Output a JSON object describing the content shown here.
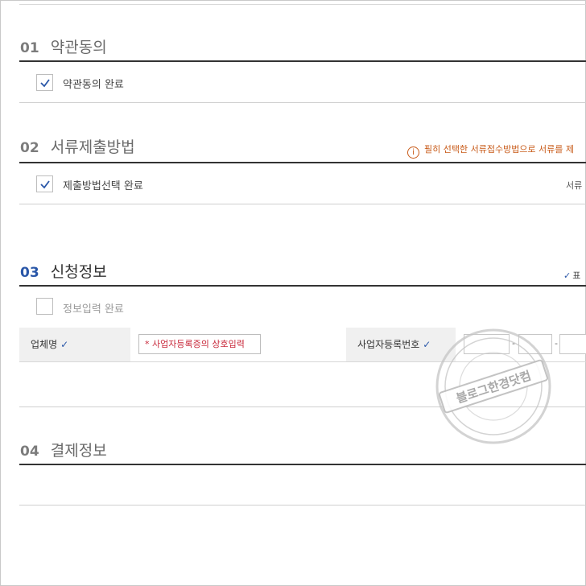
{
  "sections": [
    {
      "num": "01",
      "label": "약관동의",
      "check_label": "약관동의 완료",
      "checked": true
    },
    {
      "num": "02",
      "label": "서류제출방법",
      "check_label": "제출방법선택 완료",
      "checked": true
    },
    {
      "num": "03",
      "label": "신청정보",
      "check_label": "정보입력 완료",
      "checked": false
    },
    {
      "num": "04",
      "label": "결제정보"
    }
  ],
  "notice": {
    "icon": "info-icon",
    "text": "필히 선택한 서류접수방법으로 서류를 제"
  },
  "section2_right": "서류",
  "required_legend": "표",
  "form": {
    "company_label": "업체명",
    "company_placeholder": "* 사업자등록증의 상호입력",
    "regno_label": "사업자등록번호",
    "dash": "-"
  },
  "watermark": {
    "text": "블로그한경닷컴"
  },
  "colors": {
    "accent": "#2a57a8",
    "notice": "#c85a18",
    "required": "#c8283a"
  }
}
